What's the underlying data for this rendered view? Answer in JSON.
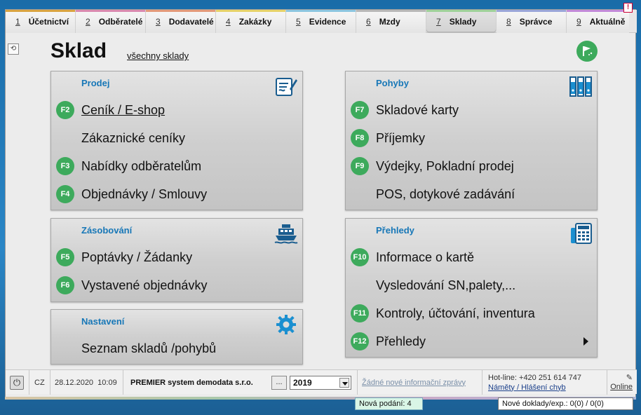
{
  "tabs": [
    {
      "num": "1",
      "label": "Účetnictví",
      "color": "#d9a441"
    },
    {
      "num": "2",
      "label": "Odběratelé",
      "color": "#d98ab0"
    },
    {
      "num": "3",
      "label": "Dodavatelé",
      "color": "#e39a7a"
    },
    {
      "num": "4",
      "label": "Zakázky",
      "color": "#e6d36a"
    },
    {
      "num": "5",
      "label": "Evidence",
      "color": "#8cc6e0"
    },
    {
      "num": "6",
      "label": "Mzdy",
      "color": "#b8b8b8"
    },
    {
      "num": "7",
      "label": "Sklady",
      "color": "#9fd29a"
    },
    {
      "num": "8",
      "label": "Správce",
      "color": "#9aa6d9"
    },
    {
      "num": "9",
      "label": "Aktuálně",
      "color": "#c28ad9"
    }
  ],
  "active_tab": "Sklady",
  "warning_icon": "!",
  "page": {
    "title": "Sklad",
    "all_link": "všechny sklady"
  },
  "panels": {
    "prodej": {
      "title": "Prodej",
      "icon": "signed-document-icon",
      "items": [
        {
          "key": "F2",
          "label": "Ceník / E-shop"
        },
        {
          "key": "",
          "label": "Zákaznické ceníky"
        },
        {
          "key": "F3",
          "label": "Nabídky odběratelům"
        },
        {
          "key": "F4",
          "label": "Objednávky / Smlouvy"
        }
      ]
    },
    "zasobovani": {
      "title": "Zásobování",
      "icon": "ship-icon",
      "items": [
        {
          "key": "F5",
          "label": "Poptávky / Žádanky"
        },
        {
          "key": "F6",
          "label": "Vystavené objednávky"
        }
      ]
    },
    "nastaveni": {
      "title": "Nastavení",
      "icon": "gear-icon",
      "items": [
        {
          "key": "",
          "label": "Seznam skladů /pohybů"
        }
      ]
    },
    "pohyby": {
      "title": "Pohyby",
      "icon": "binders-icon",
      "items": [
        {
          "key": "F7",
          "label": "Skladové karty"
        },
        {
          "key": "F8",
          "label": "Příjemky"
        },
        {
          "key": "F9",
          "label": "Výdejky, Pokladní prodej"
        },
        {
          "key": "",
          "label": "POS, dotykové zadávání"
        }
      ]
    },
    "prehledy": {
      "title": "Přehledy",
      "icon": "calculator-icon",
      "items": [
        {
          "key": "F10",
          "label": "Informace o kartě"
        },
        {
          "key": "",
          "label": "Vysledování SN,palety,..."
        },
        {
          "key": "F11",
          "label": "Kontroly, účtování, inventura"
        },
        {
          "key": "F12",
          "label": "Přehledy"
        }
      ]
    }
  },
  "status": {
    "lang": "CZ",
    "datetime": "28.12.2020  10:09",
    "company": "PREMIER system demodata s.r.o.",
    "dots": "...",
    "year": "2019",
    "messages": "Žádné nové informační zprávy",
    "hotline": "Hot-line: +420 251 614 747",
    "ideas": "Náměty / Hlášení chyb",
    "online": "Online"
  },
  "popups": {
    "nova_podani": "Nová podání:  4",
    "nove_doklady": "Nové doklady/exp.:  0(0) / 0(0)"
  },
  "colors": {
    "accent_green": "#3daa5c",
    "title_blue": "#1777b7"
  }
}
